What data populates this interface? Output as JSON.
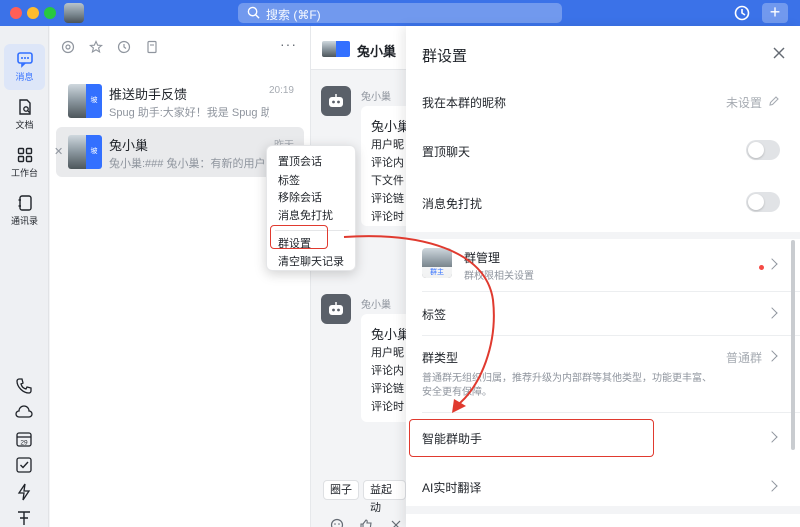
{
  "titlebar": {
    "search_placeholder": "搜索 (⌘F)"
  },
  "rail": {
    "items": [
      {
        "label": "消息",
        "icon": "message-icon"
      },
      {
        "label": "文档",
        "icon": "docs-icon"
      },
      {
        "label": "工作台",
        "icon": "workspace-icon"
      },
      {
        "label": "通讯录",
        "icon": "contacts-icon"
      }
    ],
    "bottom_icons": [
      "phone-icon",
      "cloud-icon",
      "calendar-icon",
      "task-icon",
      "lightning-icon",
      "more-tools-icon"
    ],
    "calendar_day": "29"
  },
  "convlist": {
    "conversations": [
      {
        "name": "推送助手反馈",
        "preview": "Spug 助手:大家好！我是 Spug 助手",
        "time": "20:19",
        "badge": "坡"
      },
      {
        "name": "兔小巢",
        "preview": "兔小巢:### 兔小巢：有新的用户反馈",
        "time": "昨天",
        "badge": "坡"
      }
    ]
  },
  "context_menu": {
    "items": [
      "置顶会话",
      "标签",
      "移除会话",
      "消息免打扰",
      "群设置",
      "清空聊天记录"
    ]
  },
  "chat": {
    "title": "兔小巢",
    "messages": [
      {
        "sender": "兔小巢",
        "title": "兔小巢",
        "lines": [
          "用户昵",
          "评论内",
          "下文件",
          "评论链",
          "评论时"
        ]
      },
      {
        "sender": "兔小巢",
        "title": "兔小巢",
        "lines": [
          "用户昵",
          "评论内",
          "评论链",
          "评论时"
        ]
      }
    ],
    "chips": [
      "圈子",
      "益起动"
    ]
  },
  "drawer": {
    "title": "群设置",
    "nickname_label": "我在本群的昵称",
    "nickname_value": "未设置",
    "pin_label": "置顶聊天",
    "mute_label": "消息免打扰",
    "manage_title": "群管理",
    "manage_sub": "群权限相关设置",
    "owner_badge": "群主",
    "tags_label": "标签",
    "type_label": "群类型",
    "type_value": "普通群",
    "type_desc": "普通群无组织归属，推荐升级为内部群等其他类型，功能更丰富、安全更有保障。",
    "assistant_label": "智能群助手",
    "translate_label": "AI实时翻译"
  },
  "colors": {
    "accent": "#3370ff",
    "titlebar": "#3b72e8",
    "highlight": "#e03a2f"
  }
}
